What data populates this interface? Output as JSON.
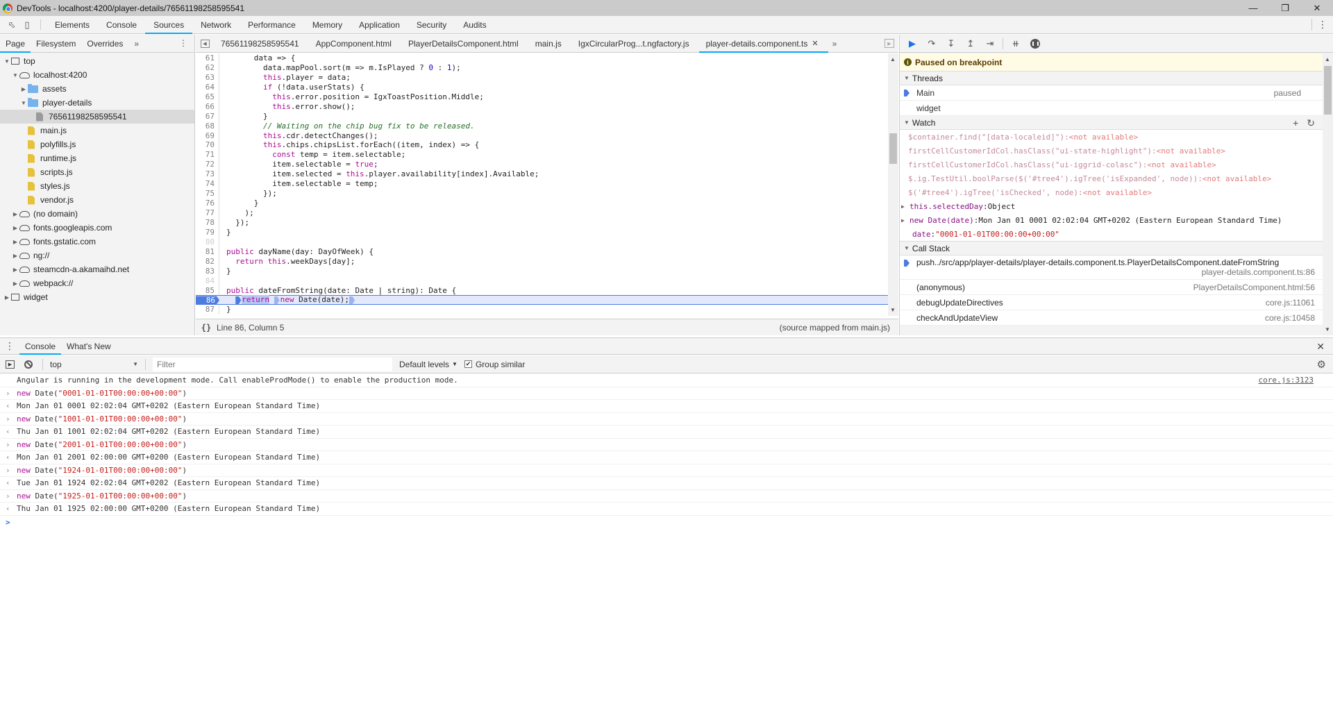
{
  "window": {
    "title": "DevTools - localhost:4200/player-details/76561198258595541",
    "controls": [
      "minimize",
      "restore",
      "close"
    ]
  },
  "main_tabs": [
    {
      "label": "Elements",
      "active": false
    },
    {
      "label": "Console",
      "active": false
    },
    {
      "label": "Sources",
      "active": true
    },
    {
      "label": "Network",
      "active": false
    },
    {
      "label": "Performance",
      "active": false
    },
    {
      "label": "Memory",
      "active": false
    },
    {
      "label": "Application",
      "active": false
    },
    {
      "label": "Security",
      "active": false
    },
    {
      "label": "Audits",
      "active": false
    }
  ],
  "navigator": {
    "tabs": [
      {
        "label": "Page",
        "active": true
      },
      {
        "label": "Filesystem",
        "active": false
      },
      {
        "label": "Overrides",
        "active": false
      }
    ],
    "more_label": "»",
    "tree": [
      {
        "label": "top",
        "icon": "frame",
        "depth": 0,
        "expanded": true
      },
      {
        "label": "localhost:4200",
        "icon": "cloud",
        "depth": 1,
        "expanded": true
      },
      {
        "label": "assets",
        "icon": "folder",
        "depth": 2,
        "expanded": false
      },
      {
        "label": "player-details",
        "icon": "folder",
        "depth": 2,
        "expanded": true
      },
      {
        "label": "76561198258595541",
        "icon": "file-gray",
        "depth": 3,
        "selected": true
      },
      {
        "label": "main.js",
        "icon": "file-yellow",
        "depth": 2
      },
      {
        "label": "polyfills.js",
        "icon": "file-yellow",
        "depth": 2
      },
      {
        "label": "runtime.js",
        "icon": "file-yellow",
        "depth": 2
      },
      {
        "label": "scripts.js",
        "icon": "file-yellow",
        "depth": 2
      },
      {
        "label": "styles.js",
        "icon": "file-yellow",
        "depth": 2
      },
      {
        "label": "vendor.js",
        "icon": "file-yellow",
        "depth": 2
      },
      {
        "label": "(no domain)",
        "icon": "cloud",
        "depth": 1,
        "expanded": false
      },
      {
        "label": "fonts.googleapis.com",
        "icon": "cloud",
        "depth": 1,
        "expanded": false
      },
      {
        "label": "fonts.gstatic.com",
        "icon": "cloud",
        "depth": 1,
        "expanded": false
      },
      {
        "label": "ng://",
        "icon": "cloud",
        "depth": 1,
        "expanded": false
      },
      {
        "label": "steamcdn-a.akamaihd.net",
        "icon": "cloud",
        "depth": 1,
        "expanded": false
      },
      {
        "label": "webpack://",
        "icon": "cloud",
        "depth": 1,
        "expanded": false
      },
      {
        "label": "widget",
        "icon": "frame",
        "depth": 0,
        "expanded": false
      }
    ]
  },
  "editor": {
    "tabs": [
      {
        "label": "76561198258595541",
        "active": false
      },
      {
        "label": "AppComponent.html",
        "active": false
      },
      {
        "label": "PlayerDetailsComponent.html",
        "active": false
      },
      {
        "label": "main.js",
        "active": false
      },
      {
        "label": "IgxCircularProg...t.ngfactory.js",
        "active": false
      },
      {
        "label": "player-details.component.ts",
        "active": true,
        "closable": true
      }
    ],
    "more_label": "»",
    "current_line": 86,
    "lines": [
      {
        "n": 61,
        "tokens": [
          [
            "id",
            "      data"
          ],
          [
            "tp",
            " => {"
          ]
        ]
      },
      {
        "n": 62,
        "tokens": [
          [
            "id",
            "        data.mapPool.sort(m => m.IsPlayed ? "
          ],
          [
            "num",
            "0"
          ],
          [
            "tp",
            " : "
          ],
          [
            "num",
            "1"
          ],
          [
            "tp",
            ");"
          ]
        ]
      },
      {
        "n": 63,
        "tokens": [
          [
            "kw",
            "        this"
          ],
          [
            "tp",
            ".player = data;"
          ]
        ]
      },
      {
        "n": 64,
        "tokens": [
          [
            "kw",
            "        if"
          ],
          [
            "tp",
            " (!data.userStats) {"
          ]
        ]
      },
      {
        "n": 65,
        "tokens": [
          [
            "kw",
            "          this"
          ],
          [
            "tp",
            ".error.position = IgxToastPosition.Middle;"
          ]
        ]
      },
      {
        "n": 66,
        "tokens": [
          [
            "kw",
            "          this"
          ],
          [
            "tp",
            ".error.show();"
          ]
        ]
      },
      {
        "n": 67,
        "tokens": [
          [
            "tp",
            "        }"
          ]
        ]
      },
      {
        "n": 68,
        "tokens": [
          [
            "cm",
            "        // Waiting on the chip bug fix to be released."
          ]
        ]
      },
      {
        "n": 69,
        "tokens": [
          [
            "kw",
            "        this"
          ],
          [
            "tp",
            ".cdr.detectChanges();"
          ]
        ]
      },
      {
        "n": 70,
        "tokens": [
          [
            "kw",
            "        this"
          ],
          [
            "tp",
            ".chips.chipsList.forEach((item, index) => {"
          ]
        ]
      },
      {
        "n": 71,
        "tokens": [
          [
            "kw",
            "          const"
          ],
          [
            "tp",
            " temp = item.selectable;"
          ]
        ]
      },
      {
        "n": 72,
        "tokens": [
          [
            "tp",
            "          item.selectable = "
          ],
          [
            "kw",
            "true"
          ],
          [
            "tp",
            ";"
          ]
        ]
      },
      {
        "n": 73,
        "tokens": [
          [
            "tp",
            "          item.selected = "
          ],
          [
            "kw",
            "this"
          ],
          [
            "tp",
            ".player.availability[index].Available;"
          ]
        ]
      },
      {
        "n": 74,
        "tokens": [
          [
            "tp",
            "          item.selectable = temp;"
          ]
        ]
      },
      {
        "n": 75,
        "tokens": [
          [
            "tp",
            "        });"
          ]
        ]
      },
      {
        "n": 76,
        "tokens": [
          [
            "tp",
            "      }"
          ]
        ]
      },
      {
        "n": 77,
        "tokens": [
          [
            "tp",
            "    );"
          ]
        ]
      },
      {
        "n": 78,
        "tokens": [
          [
            "tp",
            "  });"
          ]
        ]
      },
      {
        "n": 79,
        "tokens": [
          [
            "tp",
            "}"
          ]
        ]
      },
      {
        "n": 80,
        "tokens": [],
        "dim": true
      },
      {
        "n": 81,
        "tokens": [
          [
            "kw",
            "public"
          ],
          [
            "tp",
            " dayName(day: DayOfWeek) {"
          ]
        ]
      },
      {
        "n": 82,
        "tokens": [
          [
            "kw",
            "  return this"
          ],
          [
            "tp",
            ".weekDays[day];"
          ]
        ]
      },
      {
        "n": 83,
        "tokens": [
          [
            "tp",
            "}"
          ]
        ]
      },
      {
        "n": 84,
        "tokens": [],
        "dim": true
      },
      {
        "n": 85,
        "tokens": [
          [
            "kw",
            "public"
          ],
          [
            "tp",
            " dateFromString(date: Date | string): Date {"
          ]
        ]
      },
      {
        "n": 86,
        "tokens": [
          [
            "tp",
            "  "
          ],
          [
            "bp",
            ""
          ],
          [
            "ret",
            "return"
          ],
          [
            "tp",
            " "
          ],
          [
            "bpl",
            ""
          ],
          [
            "kw",
            "new"
          ],
          [
            "tp",
            " Date(date);"
          ],
          [
            "bpl",
            ""
          ]
        ],
        "exec": true
      },
      {
        "n": 87,
        "tokens": [
          [
            "tp",
            "}"
          ]
        ]
      }
    ],
    "status": {
      "position": "Line 86, Column 5",
      "mapped": "(source mapped from main.js)"
    }
  },
  "debugger": {
    "paused_message": "Paused on breakpoint",
    "threads": {
      "title": "Threads",
      "items": [
        {
          "name": "Main",
          "state": "paused",
          "current": true
        },
        {
          "name": "widget",
          "state": "",
          "current": false
        }
      ]
    },
    "watch": {
      "title": "Watch",
      "add_label": "+",
      "refresh_label": "↻",
      "items": [
        {
          "expr": "$container.find(\"[data-localeid]\")",
          "value": "<not available>",
          "available": false
        },
        {
          "expr": "firstCellCustomerIdCol.hasClass(\"ui-state-highlight\")",
          "value": "<not available>",
          "available": false
        },
        {
          "expr": "firstCellCustomerIdCol.hasClass(\"ui-iggrid-colasc\")",
          "value": "<not available>",
          "available": false
        },
        {
          "expr": "$.ig.TestUtil.boolParse($('#tree4').igTree('isExpanded', node))",
          "value": "<not available>",
          "available": false
        },
        {
          "expr": "$('#tree4').igTree('isChecked', node)",
          "value": "<not available>",
          "available": false
        },
        {
          "expr": "this.selectedDay",
          "value": "Object",
          "available": true,
          "expandable": true
        },
        {
          "expr": "new Date(date)",
          "value": "Mon Jan 01 0001 02:02:04 GMT+0202 (Eastern European Standard Time)",
          "available": true,
          "expandable": true
        },
        {
          "expr": "date",
          "value": "\"0001-01-01T00:00:00+00:00\"",
          "available": true,
          "string": true
        }
      ]
    },
    "call_stack": {
      "title": "Call Stack",
      "frames": [
        {
          "fn": "push../src/app/player-details/player-details.component.ts.PlayerDetailsComponent.dateFromString",
          "loc": "player-details.component.ts:86",
          "current": true
        },
        {
          "fn": "(anonymous)",
          "loc": "PlayerDetailsComponent.html:56"
        },
        {
          "fn": "debugUpdateDirectives",
          "loc": "core.js:11061"
        },
        {
          "fn": "checkAndUpdateView",
          "loc": "core.js:10458"
        }
      ]
    }
  },
  "drawer": {
    "tabs": [
      {
        "label": "Console",
        "active": true
      },
      {
        "label": "What's New",
        "active": false
      }
    ],
    "toolbar": {
      "context": "top",
      "filter_placeholder": "Filter",
      "filter_value": "",
      "levels": "Default levels",
      "group_similar_label": "Group similar",
      "group_similar_checked": true
    },
    "messages": [
      {
        "type": "log",
        "text": "Angular is running in the development mode. Call enableProdMode() to enable the production mode.",
        "source": "core.js:3123"
      },
      {
        "type": "input",
        "kw": "new",
        "pre": " Date(",
        "str": "\"0001-01-01T00:00:00+00:00\"",
        "post": ")"
      },
      {
        "type": "output",
        "text": "Mon Jan 01 0001 02:02:04 GMT+0202 (Eastern European Standard Time)"
      },
      {
        "type": "input",
        "kw": "new",
        "pre": " Date(",
        "str": "\"1001-01-01T00:00:00+00:00\"",
        "post": ")"
      },
      {
        "type": "output",
        "text": "Thu Jan 01 1001 02:02:04 GMT+0202 (Eastern European Standard Time)"
      },
      {
        "type": "input",
        "kw": "new",
        "pre": " Date(",
        "str": "\"2001-01-01T00:00:00+00:00\"",
        "post": ")"
      },
      {
        "type": "output",
        "text": "Mon Jan 01 2001 02:00:00 GMT+0200 (Eastern European Standard Time)"
      },
      {
        "type": "input",
        "kw": "new",
        "pre": " Date(",
        "str": "\"1924-01-01T00:00:00+00:00\"",
        "post": ")"
      },
      {
        "type": "output",
        "text": "Tue Jan 01 1924 02:02:04 GMT+0202 (Eastern European Standard Time)"
      },
      {
        "type": "input",
        "kw": "new",
        "pre": " Date(",
        "str": "\"1925-01-01T00:00:00+00:00\"",
        "post": ")"
      },
      {
        "type": "output",
        "text": "Thu Jan 01 1925 02:00:00 GMT+0200 (Eastern European Standard Time)"
      }
    ],
    "prompt_symbol": ">"
  }
}
